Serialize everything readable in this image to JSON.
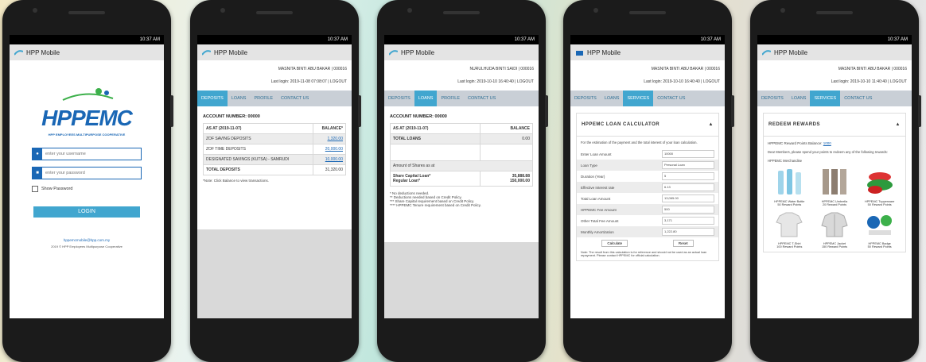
{
  "app": {
    "name": "HPP Mobile",
    "time": "10:37 AM"
  },
  "login": {
    "logo_text": "HPPEMC",
    "logo_sub": "HPP EMPLOYEES MULTIPURPOSE COOPERATIVE",
    "username_placeholder": "enter your username",
    "password_placeholder": "enter your password",
    "show_password": "Show Password",
    "login_button": "LOGIN",
    "email": "hppemcmobile@hpp.com.my",
    "copyright": "2019 © HPP Employees Multipurpose Cooperative"
  },
  "user": {
    "name_line": "MASNITA BINTI ABU BAKAR | 000016",
    "name_line_short": "NURULHUDA BINTI SAIDI | 000016",
    "last_login_1": "Last login: 2019-11-08 07:08:07 | LOGOUT",
    "last_login_2": "Last login: 2019-10-10 16:40:40 | LOGOUT",
    "last_login_3": "Last login: 2019-10-10 11:40:40 | LOGOUT"
  },
  "tabs": [
    "DEPOSITS",
    "LOANS",
    "PROFILE",
    "CONTACT US"
  ],
  "tabs_services": [
    "DEPOSITS",
    "LOANS",
    "SERVICES",
    "CONTACT US"
  ],
  "deposits": {
    "account": "ACCOUNT NUMBER: 00000",
    "as_at": "AS AT (2019-11-07)",
    "balance_h": "BALANCE*",
    "rows": [
      {
        "label": "ZOF SAVING DEPOSITS",
        "value": "1,320.00"
      },
      {
        "label": "ZOF TIME DEPOSITS",
        "value": "20,000.00"
      },
      {
        "label": "DESIGNATED SAVINGS (KUTSA) - SAMRUDI",
        "value": "10,000.00"
      }
    ],
    "total_label": "TOTAL DEPOSITS",
    "total_value": "31,320.00",
    "note": "*Note: Click Balance to view transactions."
  },
  "loans": {
    "account": "ACCOUNT NUMBER: 00000",
    "as_at": "AS AT (2019-11-07)",
    "balance_h": "BALANCE",
    "total_label": "TOTAL LOANS",
    "total_value": "0.00",
    "sub_label": "Amount of Shares as at",
    "share_label": "Share Capital Loan*",
    "share_value": "35,888.88",
    "regular_label": "Regular Loan*",
    "regular_value": "150,000.00",
    "notes": [
      "* No deductions needed.",
      "** Deductions needed based on Credit Policy.",
      "*** Share Capital requirement based on Credit Policy.",
      "**** HPPEMC Tenure requirement based on Credit Policy."
    ]
  },
  "calculator": {
    "title": "HPPEMC LOAN CALCULATOR",
    "intro": "For the estimation of the payment and the total interest of your loan calculation.",
    "rows": [
      {
        "label": "Enter Loan Amount",
        "value": "10000"
      },
      {
        "label": "Loan Type",
        "value": "Personal Loan"
      },
      {
        "label": "Duration (Year)",
        "value": "5"
      },
      {
        "label": "Effective Interest rate",
        "value": "6.13"
      },
      {
        "label": "Total Loan Amount",
        "value": "13,065.00"
      },
      {
        "label": "HPPEMC Fee Amount",
        "value": "500"
      },
      {
        "label": "Other Total Fee Amount",
        "value": "3,171"
      },
      {
        "label": "Monthly Amortization",
        "value": "1,222.80"
      }
    ],
    "calc_button": "Calculate",
    "reset_button": "Reset",
    "footnote": "Note: The result from this calculation is for reference and should not be used as an actual loan repayment. Please contact HPPEMC for official calculation."
  },
  "rewards": {
    "title": "REDEEM REWARDS",
    "points_label": "HPPEMC Reward Points Balance:",
    "points_value": "1000",
    "desc": "Dear Members, please spend your points to redeem any of the following rewards:",
    "section": "HPPEMC Merchandise",
    "items": [
      {
        "name": "HPPEMC Water Bottle",
        "points": "50 Reward Points"
      },
      {
        "name": "HPPEMC Umbrella",
        "points": "20 Reward Points"
      },
      {
        "name": "HPPEMC Tupperware",
        "points": "50 Reward Points"
      },
      {
        "name": "HPPEMC T-Shirt",
        "points": "100 Reward Points"
      },
      {
        "name": "HPPEMC Jacket",
        "points": "150 Reward Points"
      },
      {
        "name": "HPPEMC Badge",
        "points": "50 Reward Points"
      }
    ]
  },
  "icons": {
    "arrow_up": "chevron-up-icon",
    "person": "user-icon",
    "lock": "lock-icon"
  }
}
